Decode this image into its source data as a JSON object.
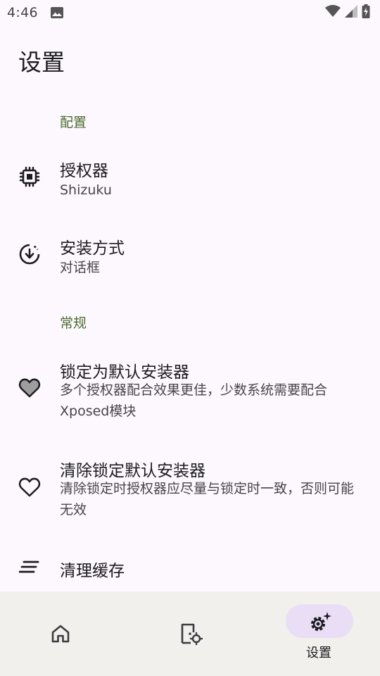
{
  "status_bar": {
    "time": "4:46",
    "icons": [
      "image-icon",
      "wifi-icon",
      "signal-icon",
      "battery-charging-icon"
    ]
  },
  "page": {
    "title": "设置"
  },
  "sections": {
    "config": {
      "header": "配置",
      "items": [
        {
          "title": "授权器",
          "subtitle": "Shizuku",
          "icon": "chip-icon"
        },
        {
          "title": "安装方式",
          "subtitle": "对话框",
          "icon": "download-circle-icon"
        }
      ]
    },
    "general": {
      "header": "常规",
      "items": [
        {
          "title": "锁定为默认安装器",
          "subtitle": "多个授权器配合效果更佳，少数系统需要配合Xposed模块",
          "icon": "heart-filled-icon"
        },
        {
          "title": "清除锁定默认安装器",
          "subtitle": "清除锁定时授权器应尽量与锁定时一致，否则可能无效",
          "icon": "heart-outline-icon"
        },
        {
          "title": "清理缓存",
          "icon": "clear-all-icon"
        }
      ]
    }
  },
  "bottom_nav": {
    "items": [
      {
        "id": "home",
        "icon": "home-icon",
        "label": "",
        "selected": false
      },
      {
        "id": "installer-settings",
        "icon": "door-gear-icon",
        "label": "",
        "selected": false
      },
      {
        "id": "settings",
        "icon": "settings-sparkle-icon",
        "label": "设置",
        "selected": true
      }
    ]
  },
  "colors": {
    "background": "#fdf8fd",
    "section_header": "#4b6b2f",
    "nav_background": "#f1f0ec",
    "nav_selected_pill": "#e9def5"
  }
}
